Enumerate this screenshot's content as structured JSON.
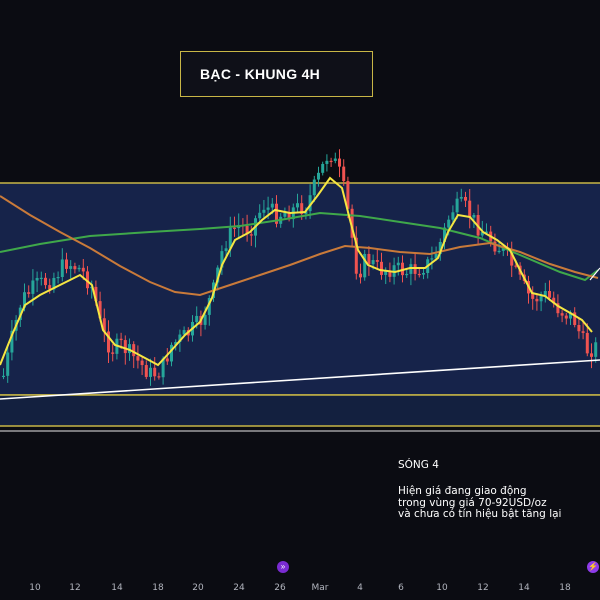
{
  "title": "BẠC - KHUNG 4H",
  "annotation": {
    "heading": "SÓNG 4",
    "lines": [
      "Hiện giá đang giao động",
      "trong vùng giá 70-92USD/oz",
      "và chưa có tín hiệu bật tăng lại"
    ]
  },
  "x_ticks": [
    "10",
    "12",
    "14",
    "18",
    "20",
    "24",
    "26",
    "Mar",
    "4",
    "6",
    "10",
    "12",
    "14",
    "18"
  ],
  "event_icons": [
    "event-flag-icon",
    "event-flag-icon"
  ],
  "colors": {
    "background": "#0b0c12",
    "zone_fill": "#16234a",
    "zone_border": "#c8b646",
    "candle_up": "#26a69a",
    "candle_down": "#ef5350",
    "ma_fast": "#f5e642",
    "ma_mid": "#c97a3a",
    "ma_slow": "#3fa84a",
    "trendline": "#ffffff"
  },
  "chart_data": {
    "type": "candlestick",
    "symbol": "Silver",
    "timeframe": "4H",
    "price_zone_usd_oz": [
      70,
      92
    ],
    "indicators": [
      "moving-average-fast",
      "moving-average-mid",
      "moving-average-slow"
    ],
    "trendline": "rising support",
    "grid": false
  }
}
